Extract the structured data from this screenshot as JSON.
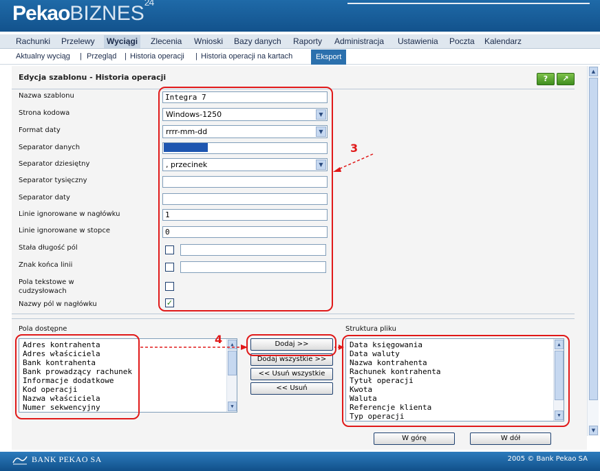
{
  "brand": {
    "name_bold": "Pekao",
    "name_light": "BIZNES",
    "superscript": "24"
  },
  "main_menu": [
    "Rachunki",
    "Przelewy",
    "Wyciągi",
    "Zlecenia",
    "Wnioski",
    "Bazy danych",
    "Raporty",
    "Administracja",
    "Ustawienia",
    "Poczta",
    "Kalendarz"
  ],
  "main_menu_active": "Wyciągi",
  "sub_menu": [
    "Aktualny wyciąg",
    "Przegląd",
    "Historia operacji",
    "Historia operacji na kartach",
    "Eksport"
  ],
  "sub_menu_separator": "|",
  "sub_menu_active": "Eksport",
  "page_title": "Edycja szablonu - Historia operacji",
  "header_buttons": {
    "help": "?",
    "expand": "↗"
  },
  "form": {
    "template_name_label": "Nazwa szablonu",
    "template_name_value": "Integra 7",
    "encoding_label": "Strona kodowa",
    "encoding_value": "Windows-1250",
    "date_format_label": "Format daty",
    "date_format_value": "rrrr-mm-dd",
    "data_separator_label": "Separator danych",
    "data_separator_value": "",
    "decimal_separator_label": "Separator dziesiętny",
    "decimal_separator_value": ", przecinek",
    "thousands_separator_label": "Separator tysięczny",
    "thousands_separator_value": "",
    "date_separator_label": "Separator daty",
    "date_separator_value": "",
    "header_lines_label": "Linie ignorowane w nagłówku",
    "header_lines_value": "1",
    "footer_lines_label": "Linie ignorowane w stopce",
    "footer_lines_value": "0",
    "fixed_length_label": "Stała długość pól",
    "fixed_length_checked": false,
    "line_end_label": "Znak końca linii",
    "line_end_checked": false,
    "text_fields_quoted_label": "Pola tekstowe w cudzysłowach",
    "text_fields_quoted_checked": false,
    "field_names_header_label": "Nazwy pól w nagłówku",
    "field_names_header_checked": true
  },
  "annotations": {
    "marker_3": "3",
    "marker_4": "4"
  },
  "fields": {
    "available_label": "Pola dostępne",
    "available": [
      "Adres kontrahenta",
      "Adres właściciela",
      "Bank kontrahenta",
      "Bank prowadzący rachunek",
      "Informacje dodatkowe",
      "Kod operacji",
      "Nazwa właściciela",
      "Numer sekwencyjny"
    ],
    "structure_label": "Struktura pliku",
    "structure": [
      "Data księgowania",
      "Data waluty",
      "Nazwa kontrahenta",
      "Rachunek kontrahenta",
      "Tytuł operacji",
      "Kwota",
      "Waluta",
      "Referencje klienta",
      "Typ operacji"
    ]
  },
  "buttons": {
    "add": "Dodaj >>",
    "add_all": "Dodaj wszystkie >>",
    "remove_all": "<< Usuń wszystkie",
    "remove": "<< Usuń",
    "move_up": "W górę",
    "move_down": "W dół"
  },
  "footer": {
    "bank": "BANK PEKAO SA",
    "copyright": "2005 © Bank Pekao SA"
  },
  "colors": {
    "header_blue": "#11508a",
    "accent_blue": "#2b70ad",
    "annotation_red": "#e01818",
    "help_green": "#3f8d1f"
  }
}
